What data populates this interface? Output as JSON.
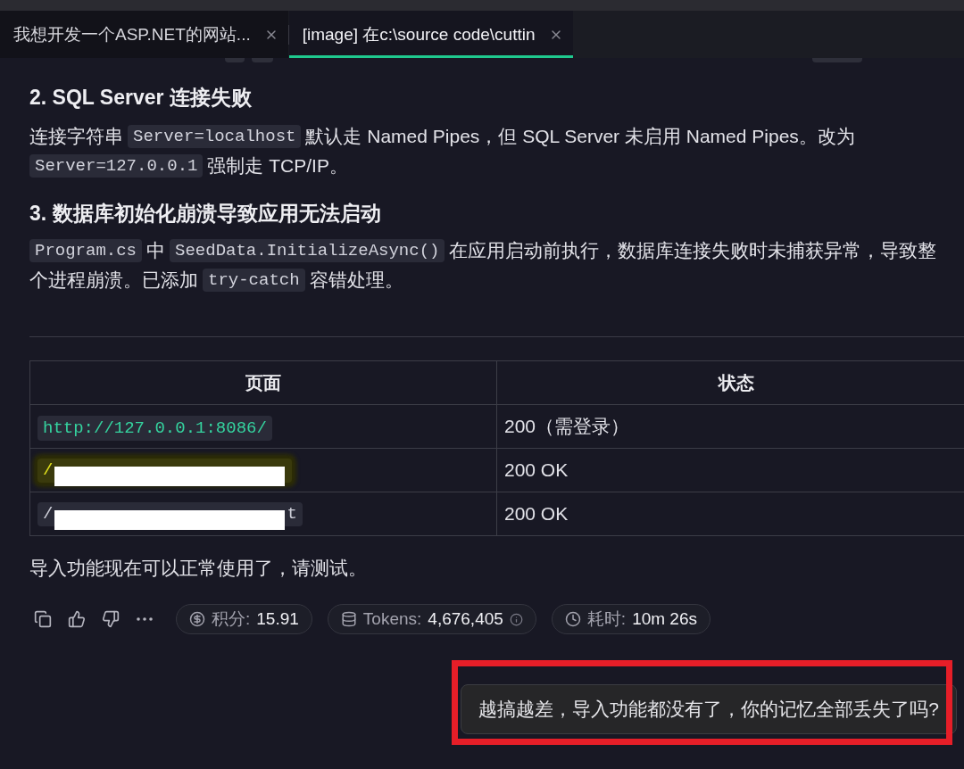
{
  "tabs": [
    {
      "label": "我想开发一个ASP.NET的网站...",
      "selected": false
    },
    {
      "label": "[image] 在c:\\source code\\cuttin",
      "selected": true
    }
  ],
  "message": {
    "sections": [
      {
        "heading": "2. SQL Server 连接失败",
        "lines": [
          [
            {
              "kind": "text",
              "text": "连接字符串"
            },
            {
              "kind": "code",
              "text": "Server=localhost"
            },
            {
              "kind": "text",
              "text": "默认走 Named Pipes，但 SQL Server 未启用 Named Pipes。改为"
            }
          ],
          [
            {
              "kind": "code",
              "text": "Server=127.0.0.1"
            },
            {
              "kind": "text",
              "text": "强制走 TCP/IP。"
            }
          ]
        ]
      },
      {
        "heading": "3. 数据库初始化崩溃导致应用无法启动",
        "lines": [
          [
            {
              "kind": "code",
              "text": "Program.cs"
            },
            {
              "kind": "text",
              "text": "中"
            },
            {
              "kind": "code",
              "text": "SeedData.InitializeAsync()"
            },
            {
              "kind": "text",
              "text": "在应用启动前执行，数据库连接失败时未捕获异常，导致整"
            }
          ],
          [
            {
              "kind": "text",
              "text": "个进程崩溃。已添加"
            },
            {
              "kind": "code",
              "text": "try-catch"
            },
            {
              "kind": "text",
              "text": "容错处理。"
            }
          ]
        ]
      }
    ],
    "table": {
      "columns": [
        "页面",
        "状态"
      ],
      "rows": [
        {
          "page": {
            "kind": "link",
            "text": "http://127.0.0.1:8086/",
            "highlighted": false,
            "redacted": false
          },
          "status": "200（需登录）"
        },
        {
          "page": {
            "kind": "path",
            "text": "/",
            "highlighted": true,
            "redacted": true
          },
          "status": "200 OK"
        },
        {
          "page": {
            "kind": "path",
            "text": "/",
            "tail": "t",
            "highlighted": false,
            "redacted": true
          },
          "status": "200 OK"
        }
      ]
    },
    "closing": "导入功能现在可以正常使用了，请测试。",
    "stats": [
      {
        "kind": "credits",
        "label": "积分:",
        "value": "15.91"
      },
      {
        "kind": "tokens",
        "label": "Tokens:",
        "value": "4,676,405"
      },
      {
        "kind": "time",
        "label": "耗时:",
        "value": "10m 26s"
      }
    ]
  },
  "user_message": {
    "text": "越搞越差，导入功能都没有了，你的记忆全部丢失了吗?",
    "annotated": true
  }
}
